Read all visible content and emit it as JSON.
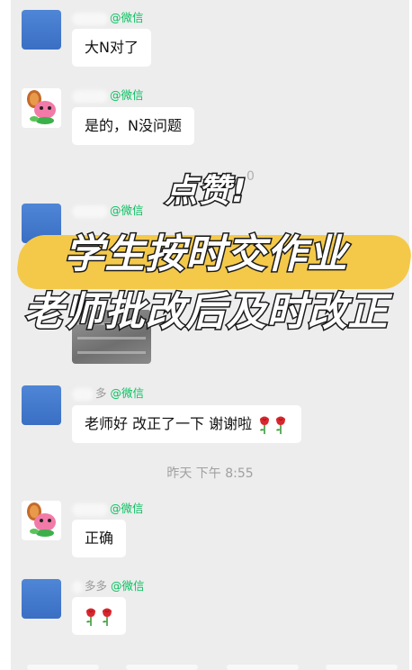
{
  "messages": [
    {
      "sender_suffix": "@微信",
      "text": "大N对了"
    },
    {
      "sender_suffix": "@微信",
      "text": "是的，N没问题"
    },
    {
      "sender_suffix": "@微信"
    },
    {
      "sender_prefix": "多",
      "sender_suffix": "@微信",
      "text": "老师好 改正了一下 谢谢啦"
    },
    {
      "sender_suffix": "@微信",
      "text": "正确"
    },
    {
      "sender_prefix": "多多",
      "sender_suffix": "@微信"
    }
  ],
  "timestamp": "昨天 下午 8:55",
  "ghost_time": "0",
  "overlay": {
    "line1": "点赞!",
    "line2": "学生按时交作业",
    "line3": "老师批改后及时改正"
  },
  "colors": {
    "wechat_green": "#07c160",
    "highlight_yellow": "#f4c94a",
    "bg": "#ededed"
  }
}
